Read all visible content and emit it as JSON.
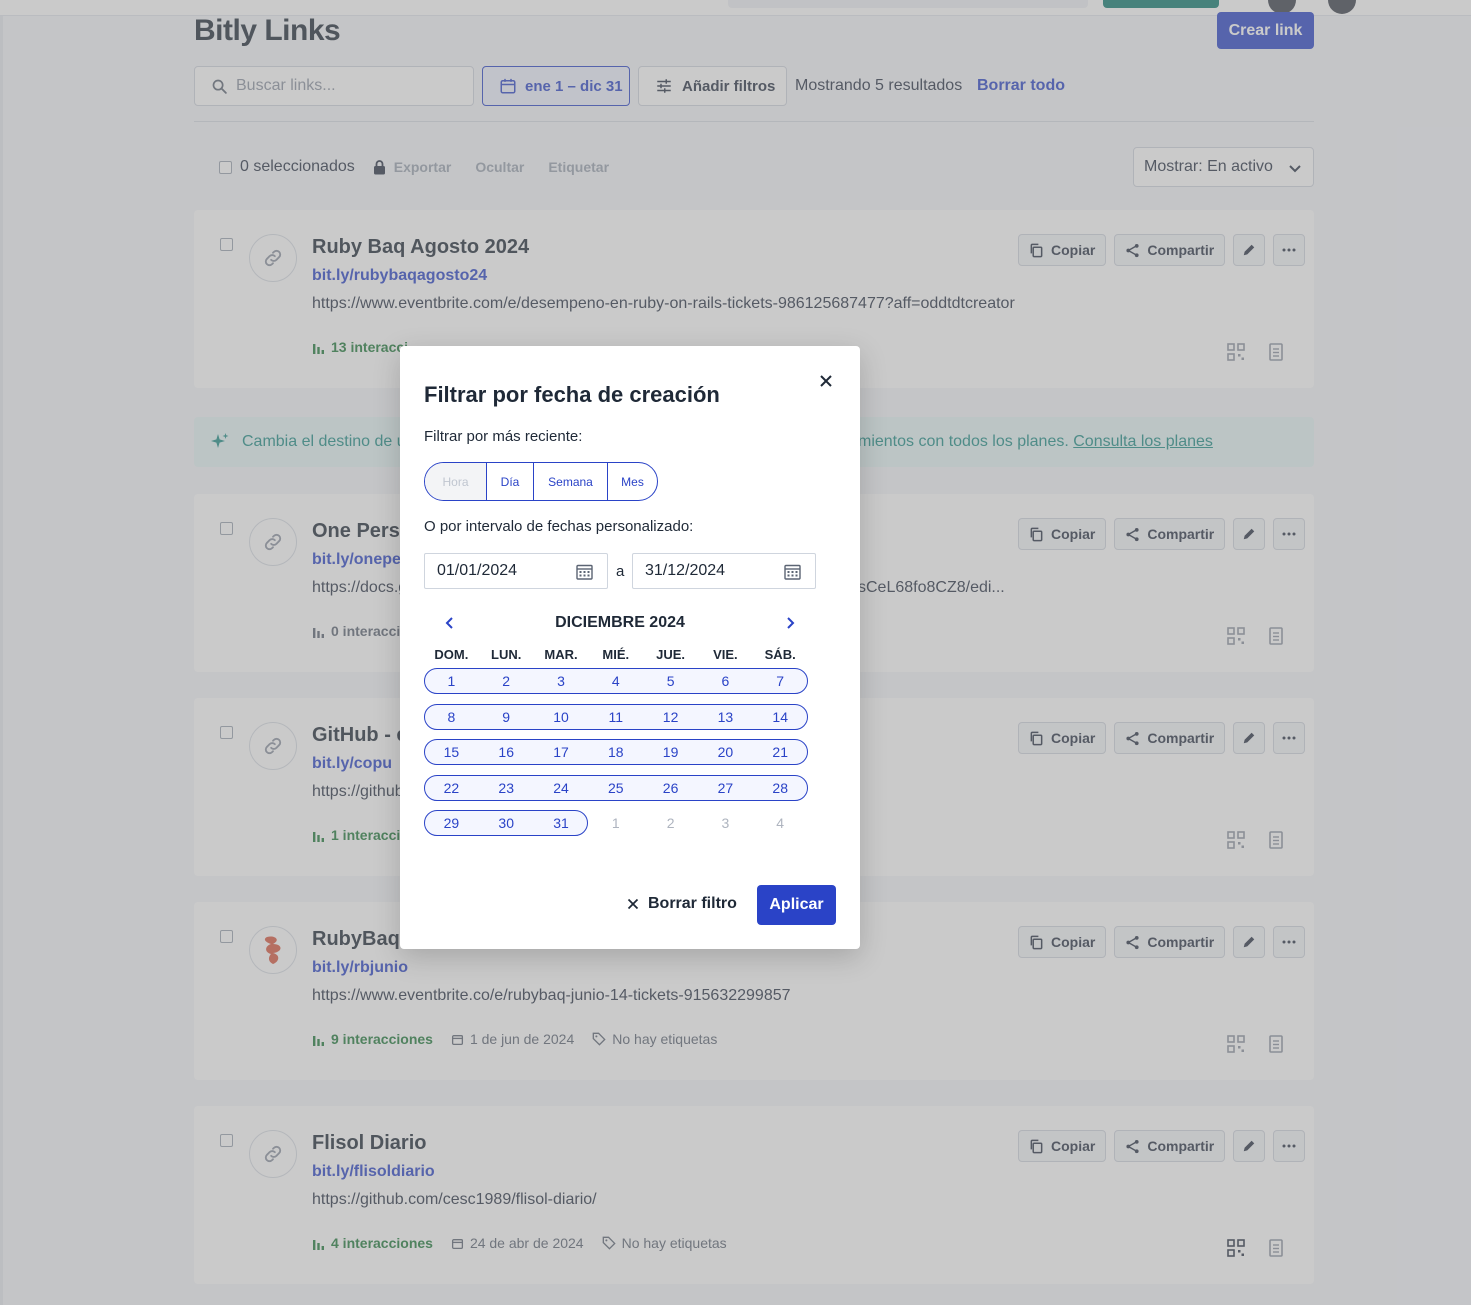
{
  "page": {
    "title": "Bitly Links",
    "create_label": "Crear link",
    "search_placeholder": "Buscar links...",
    "date_filter_label": "ene 1 – dic 31",
    "add_filters_label": "Añadir filtros",
    "results_text": "Mostrando 5 resultados",
    "clear_all_label": "Borrar todo",
    "selected_text": "0 seleccionados",
    "export_label": "Exportar",
    "hide_label": "Ocultar",
    "tag_label": "Etiquetar",
    "show_select_value": "Mostrar: En activo"
  },
  "banner": {
    "text_left": "Cambia el destino de un",
    "text_right": "mientos con todos los planes.",
    "link": "Consulta los planes"
  },
  "card_actions": {
    "copy": "Copiar",
    "share": "Compartir"
  },
  "links": [
    {
      "title": "Ruby Baq Agosto 2024",
      "short": "bit.ly/rubybaqagosto24",
      "long": "https://www.eventbrite.com/e/desempeno-en-ruby-on-rails-tickets-986125687477?aff=oddtdtcreator",
      "engagements": "13 interacci",
      "date": "",
      "tags": ""
    },
    {
      "title": "One Perso",
      "short": "bit.ly/oneper",
      "long": "https://docs.g",
      "long_tail": "sCeL68fo8CZ8/edi...",
      "engagements": "0 interacci",
      "date": "",
      "tags": ""
    },
    {
      "title": "GitHub - c",
      "short": "bit.ly/copu",
      "long": "https://github",
      "engagements": "1 interacció",
      "date": "",
      "tags": ""
    },
    {
      "title": "RubyBaq J",
      "short": "bit.ly/rbjunio",
      "long": "https://www.eventbrite.co/e/rubybaq-junio-14-tickets-915632299857",
      "engagements": "9 interacciones",
      "date": "1 de jun de 2024",
      "tags": "No hay etiquetas"
    },
    {
      "title": "Flisol Diario",
      "short": "bit.ly/flisoldiario",
      "long": "https://github.com/cesc1989/flisol-diario/",
      "engagements": "4 interacciones",
      "date": "24 de abr de 2024",
      "tags": "No hay etiquetas"
    }
  ],
  "modal": {
    "title": "Filtrar por fecha de creación",
    "recent_label": "Filtrar por más reciente:",
    "segments": [
      "Hora",
      "Día",
      "Semana",
      "Mes"
    ],
    "range_label": "O por intervalo de fechas personalizado:",
    "start_date": "01/01/2024",
    "separator": "a",
    "end_date": "31/12/2024",
    "month_label": "DICIEMBRE 2024",
    "weekdays": [
      "DOM.",
      "LUN.",
      "MAR.",
      "MIÉ.",
      "JUE.",
      "VIE.",
      "SÁB."
    ],
    "weeks": [
      [
        "1",
        "2",
        "3",
        "4",
        "5",
        "6",
        "7"
      ],
      [
        "8",
        "9",
        "10",
        "11",
        "12",
        "13",
        "14"
      ],
      [
        "15",
        "16",
        "17",
        "18",
        "19",
        "20",
        "21"
      ],
      [
        "22",
        "23",
        "24",
        "25",
        "26",
        "27",
        "28"
      ],
      [
        "29",
        "30",
        "31",
        "1",
        "2",
        "3",
        "4"
      ]
    ],
    "clear_filter_label": "Borrar filtro",
    "apply_label": "Aplicar"
  },
  "colors": {
    "accent": "#2a43c7",
    "engagement_green": "#1f7a3a",
    "banner_teal": "#1c8c86"
  },
  "icons": {
    "search": "search-icon",
    "calendar": "calendar-icon",
    "filters": "sliders-icon",
    "lock": "lock-icon",
    "chevron": "chevron-down-icon",
    "copy": "copy-icon",
    "share": "share-icon",
    "edit": "pencil-icon",
    "more": "more-icon",
    "link": "link-icon",
    "qr": "qr-code-icon",
    "doc": "page-icon",
    "sparkle": "sparkle-icon",
    "close": "close-icon"
  }
}
